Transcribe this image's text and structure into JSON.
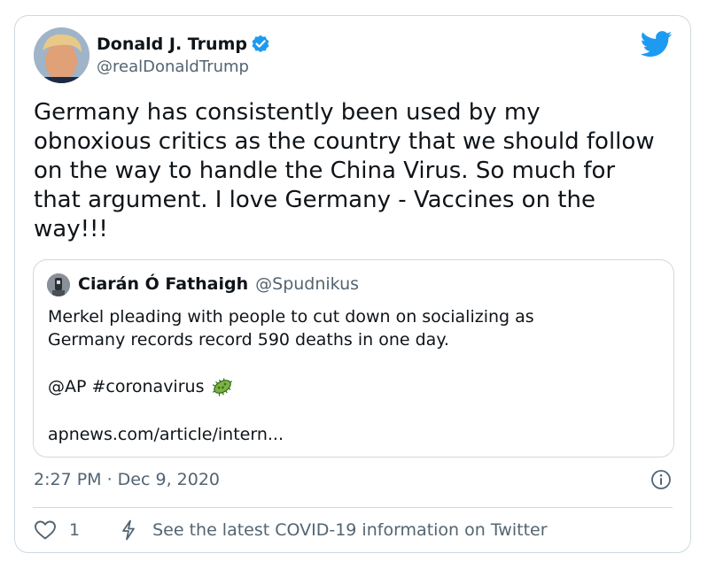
{
  "tweet": {
    "author": {
      "display_name": "Donald J. Trump",
      "handle": "@realDonaldTrump",
      "verified": true
    },
    "text": "Germany has consistently been used by my\nobnoxious critics as the country that we should follow\non the way to handle the China Virus. So much for\nthat argument. I love Germany - Vaccines on the\nway!!!",
    "timestamp": "2:27 PM · Dec 9, 2020",
    "quoted": {
      "display_name": "Ciarán Ó Fathaigh",
      "handle": "@Spudnikus",
      "text": "Merkel pleading with people to cut down on socializing as\nGermany records record 590 deaths in one day.",
      "tags": "@AP #coronavirus",
      "link": "apnews.com/article/intern..."
    },
    "footer": {
      "like_count": "1",
      "covid_info": "See the latest COVID-19 information on Twitter"
    }
  },
  "icons": {
    "verified": "verified-badge-icon",
    "brand": "twitter-bird-icon",
    "virus": "microbe-emoji-icon",
    "info": "info-icon",
    "like": "heart-icon",
    "covid": "lightning-bolt-icon"
  },
  "colors": {
    "twitter_blue": "#1d9bf0",
    "secondary_text": "#536471",
    "border": "#cfd9de",
    "primary_text": "#0f1419"
  }
}
